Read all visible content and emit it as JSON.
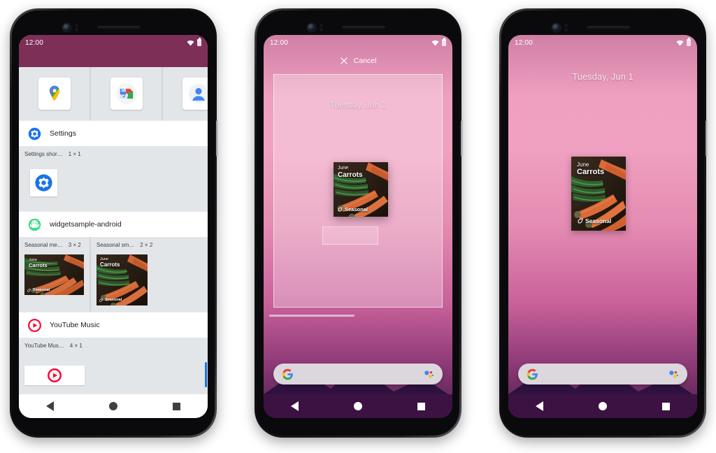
{
  "phones": [
    {
      "id": "widget-picker",
      "status": {
        "clock": "12:00",
        "wifi": "wifi-icon",
        "battery": "battery-icon"
      },
      "app_row": [
        {
          "label": "Maps",
          "icon": "google-maps-icon"
        },
        {
          "label": "Maps Go",
          "icon": "maps-go-icon"
        },
        {
          "label": "Contacts",
          "icon": "contacts-icon"
        }
      ],
      "groups": [
        {
          "app_name": "Settings",
          "app_icon": "settings-gear-icon",
          "widgets": [
            {
              "title": "Settings shor…",
              "size": "1 × 1",
              "preview": "settings-shortcut"
            }
          ]
        },
        {
          "app_name": "widgetsample-android",
          "app_icon": "android-bugdroid-icon",
          "widgets": [
            {
              "title": "Seasonal me…",
              "size": "3 × 2",
              "preview": "carrots-wide",
              "month": "June",
              "produce": "Carrots",
              "tag": "Seasonal"
            },
            {
              "title": "Seasonal sm…",
              "size": "2 × 2",
              "preview": "carrots-square",
              "month": "June",
              "produce": "Carrots",
              "tag": "Seasonal"
            }
          ]
        },
        {
          "app_name": "YouTube Music",
          "app_icon": "youtube-music-icon",
          "widgets": [
            {
              "title": "YouTube Mus…",
              "size": "4 × 1",
              "preview": "yt-music-bar"
            }
          ]
        }
      ]
    },
    {
      "id": "widget-placement",
      "status": {
        "clock": "12:00",
        "wifi": "wifi-icon",
        "battery": "battery-icon"
      },
      "cancel_label": "Cancel",
      "cancel_icon": "close-icon",
      "date": "Tuesday, Jun 1",
      "widget": {
        "month": "June",
        "produce": "Carrots",
        "tag": "Seasonal"
      }
    },
    {
      "id": "home-screen",
      "status": {
        "clock": "12:00",
        "wifi": "wifi-icon",
        "battery": "battery-icon"
      },
      "date": "Tuesday, Jun 1",
      "widget": {
        "month": "June",
        "produce": "Carrots",
        "tag": "Seasonal"
      },
      "search": {
        "logo": "google-g-icon",
        "assistant": "google-assistant-icon"
      }
    }
  ],
  "nav": {
    "back": "back-icon",
    "home": "home-icon",
    "recents": "recents-icon"
  },
  "colors": {
    "status_bar_picker": "#7d2f57",
    "picker_bg": "#e3e6e9",
    "accent_blue": "#1a73e8",
    "wallpaper_top": "#ef9fc0",
    "wallpaper_bottom": "#4c1f4b"
  }
}
